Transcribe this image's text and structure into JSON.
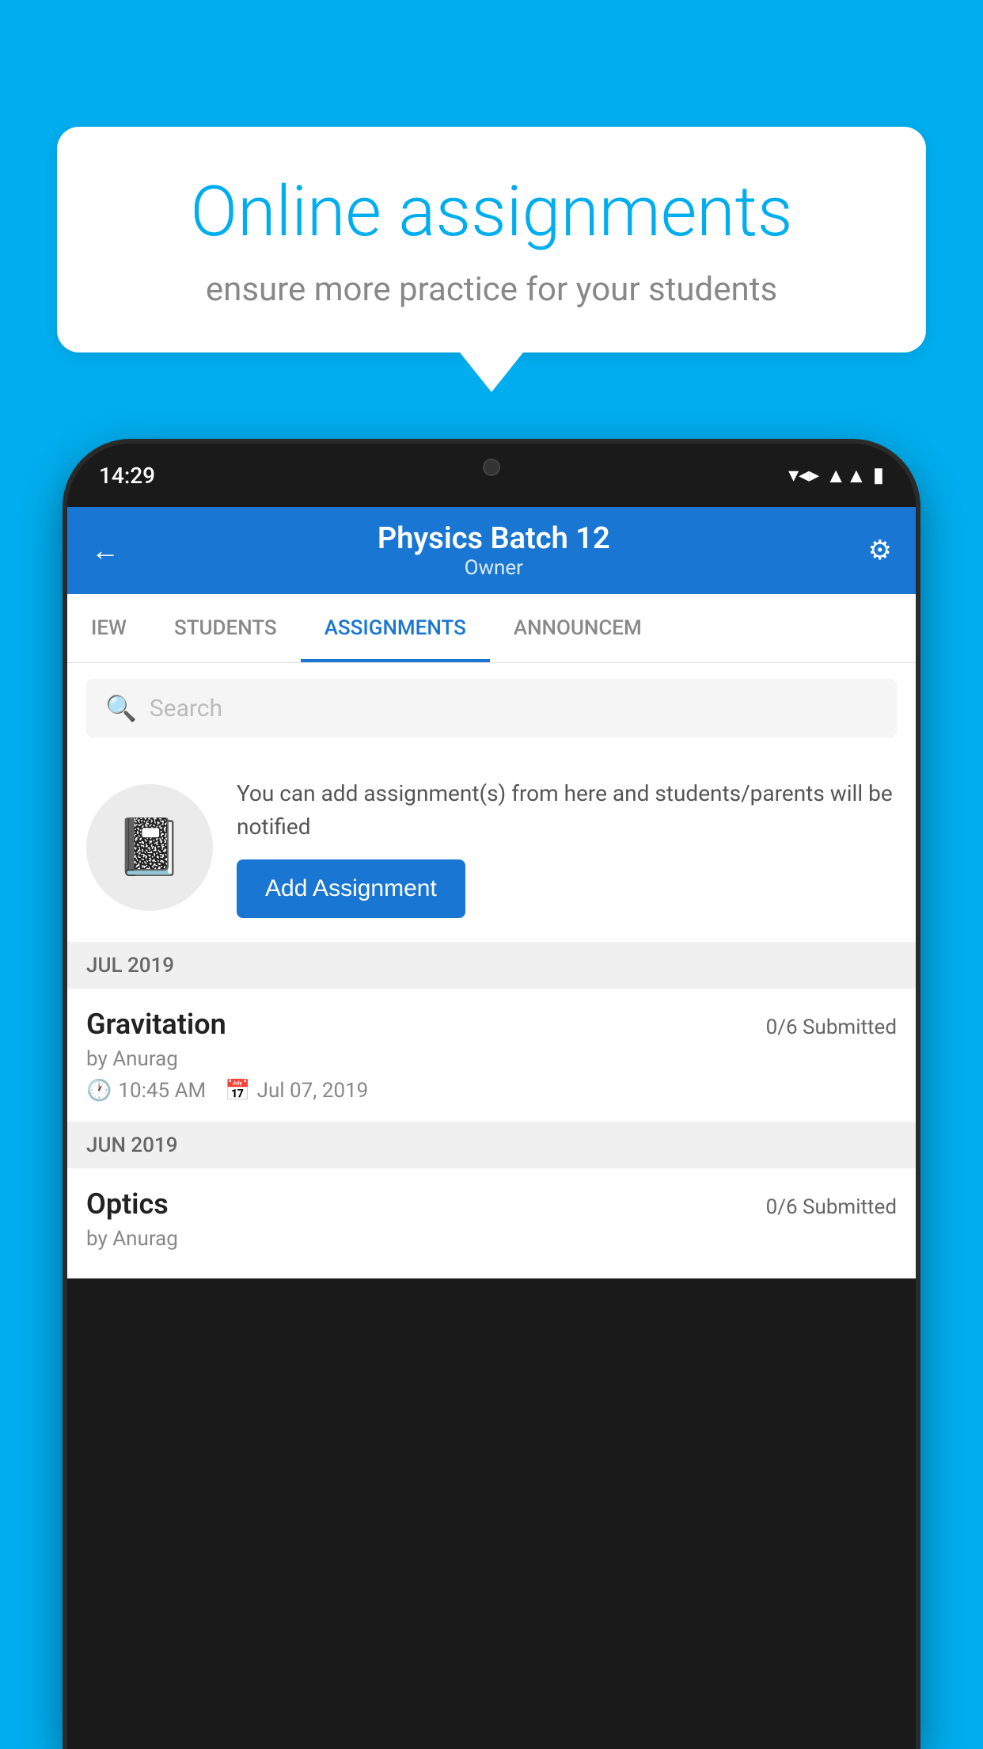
{
  "background": {
    "color": "#00AEEF"
  },
  "speech_bubble": {
    "title": "Online assignments",
    "subtitle": "ensure more practice for your students"
  },
  "status_bar": {
    "time": "14:29",
    "icons": [
      "wifi",
      "signal",
      "battery"
    ]
  },
  "app_header": {
    "title": "Physics Batch 12",
    "subtitle": "Owner",
    "back_label": "←",
    "settings_label": "⚙"
  },
  "tabs": [
    {
      "label": "IEW",
      "active": false
    },
    {
      "label": "STUDENTS",
      "active": false
    },
    {
      "label": "ASSIGNMENTS",
      "active": true
    },
    {
      "label": "ANNOUNCEM",
      "active": false
    }
  ],
  "search": {
    "placeholder": "Search"
  },
  "info_card": {
    "description": "You can add assignment(s) from here and students/parents will be notified",
    "button_label": "Add Assignment"
  },
  "sections": [
    {
      "header": "JUL 2019",
      "assignments": [
        {
          "name": "Gravitation",
          "submitted": "0/6 Submitted",
          "author": "by Anurag",
          "time": "10:45 AM",
          "date": "Jul 07, 2019"
        }
      ]
    },
    {
      "header": "JUN 2019",
      "assignments": [
        {
          "name": "Optics",
          "submitted": "0/6 Submitted",
          "author": "by Anurag",
          "time": "",
          "date": ""
        }
      ]
    }
  ]
}
